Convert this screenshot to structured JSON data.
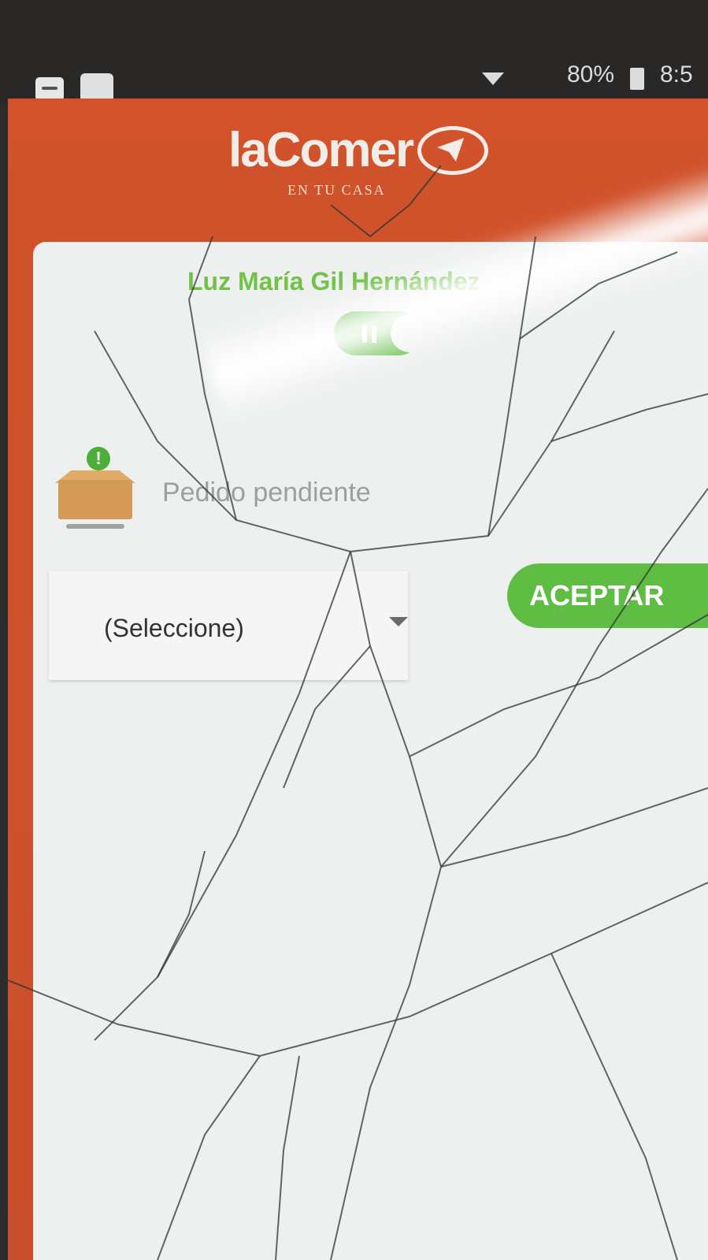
{
  "status_bar": {
    "battery": "80%",
    "clock": "8:5",
    "icons": [
      "message-icon",
      "square-notification-icon",
      "wifi-icon",
      "battery-icon"
    ]
  },
  "header": {
    "logo": "laComer",
    "tagline": "EN TU CASA"
  },
  "card": {
    "user_name": "Luz María Gil Hernández",
    "order_label": "Pedido pendiente",
    "select": {
      "value": "(Seleccione)"
    },
    "accept_label": "ACEPTAR"
  },
  "colors": {
    "brand_orange": "#d1522b",
    "accent_green": "#5fbd44",
    "card_bg": "#eef0f0"
  }
}
